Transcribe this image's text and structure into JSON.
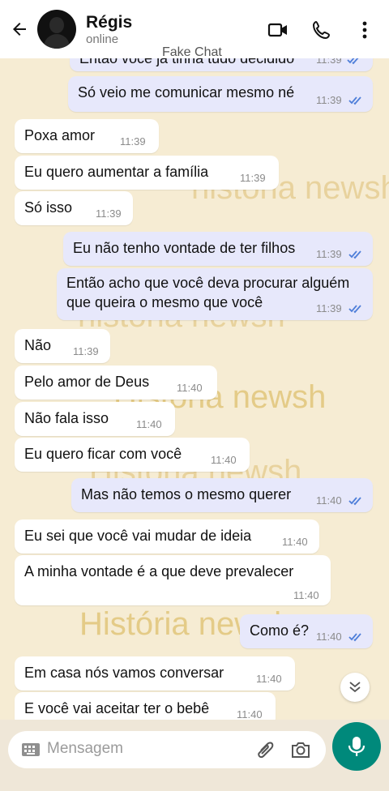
{
  "header": {
    "contact_name": "Régis",
    "status": "online",
    "overlay_title": "Fake Chat",
    "icons": [
      "back-arrow-icon",
      "video-call-icon",
      "phone-icon",
      "more-vert-icon"
    ]
  },
  "watermark": {
    "texts": [
      "história newsh",
      "história newsh",
      "História newsh",
      "História newsh",
      "História newsh"
    ]
  },
  "messages": [
    {
      "dir": "out",
      "text": "Então você já tinha tudo decidido",
      "time": "11:39",
      "read": true
    },
    {
      "dir": "out",
      "text": "Só veio me comunicar mesmo né",
      "time": "11:39",
      "read": true
    },
    {
      "dir": "in",
      "text": "Poxa amor",
      "time": "11:39"
    },
    {
      "dir": "in",
      "text": "Eu quero aumentar a família",
      "time": "11:39"
    },
    {
      "dir": "in",
      "text": "Só isso",
      "time": "11:39"
    },
    {
      "dir": "out",
      "text": "Eu não tenho vontade de ter filhos",
      "time": "11:39",
      "read": true
    },
    {
      "dir": "out",
      "text": "Então acho que você deva procurar alguém",
      "text2": "que queira o mesmo que você",
      "time": "11:39",
      "read": true
    },
    {
      "dir": "in",
      "text": "Não",
      "time": "11:39"
    },
    {
      "dir": "in",
      "text": "Pelo amor de Deus",
      "time": "11:40"
    },
    {
      "dir": "in",
      "text": "Não fala isso",
      "time": "11:40"
    },
    {
      "dir": "in",
      "text": "Eu quero ficar com você",
      "time": "11:40"
    },
    {
      "dir": "out",
      "text": "Mas não temos o mesmo querer",
      "time": "11:40",
      "read": true
    },
    {
      "dir": "in",
      "text": "Eu sei que você vai mudar de ideia",
      "time": "11:40"
    },
    {
      "dir": "in",
      "text": "A minha vontade é a que deve prevalecer",
      "time": "11:40"
    },
    {
      "dir": "out",
      "text": "Como é?",
      "time": "11:40",
      "read": true
    },
    {
      "dir": "in",
      "text": "Em casa nós vamos conversar",
      "time": "11:40"
    },
    {
      "dir": "in",
      "text": "E você vai aceitar ter o bebê",
      "time": "11:40"
    }
  ],
  "composer": {
    "placeholder": "Mensagem",
    "icons": [
      "keyboard-icon",
      "attach-icon",
      "camera-icon",
      "mic-icon"
    ]
  },
  "colors": {
    "chat_bg": "#f6ecd3",
    "incoming": "#ffffff",
    "outgoing": "#e7e8fb",
    "read_ticks": "#4f7fd9",
    "accent": "#00897b"
  }
}
